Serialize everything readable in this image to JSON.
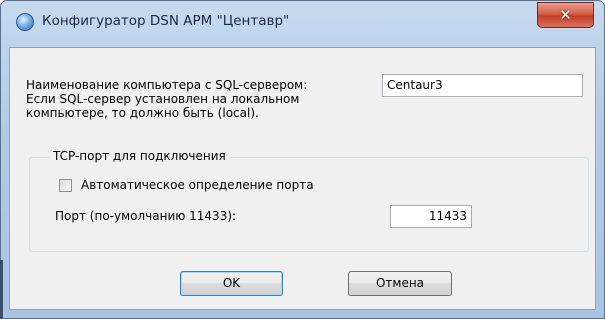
{
  "window": {
    "title": "Конфигуратор DSN АРМ \"Центавр\"",
    "close_symbol": "✕",
    "icon": "app-globe-icon"
  },
  "server": {
    "label": "Наименование компьютера с SQL-сервером:",
    "hint_line1": "Если SQL-сервер установлен на локальном",
    "hint_line2": "компьютере, то должно быть (local).",
    "value": "Centaur3"
  },
  "tcp_group": {
    "legend": "TCP-порт для подключения",
    "auto_detect_label": "Автоматическое определение порта",
    "auto_detect_checked": false,
    "port_label": "Порт (по-умолчанию 11433):",
    "port_value": "11433"
  },
  "buttons": {
    "ok_label": "OK",
    "cancel_label": "Отмена"
  }
}
